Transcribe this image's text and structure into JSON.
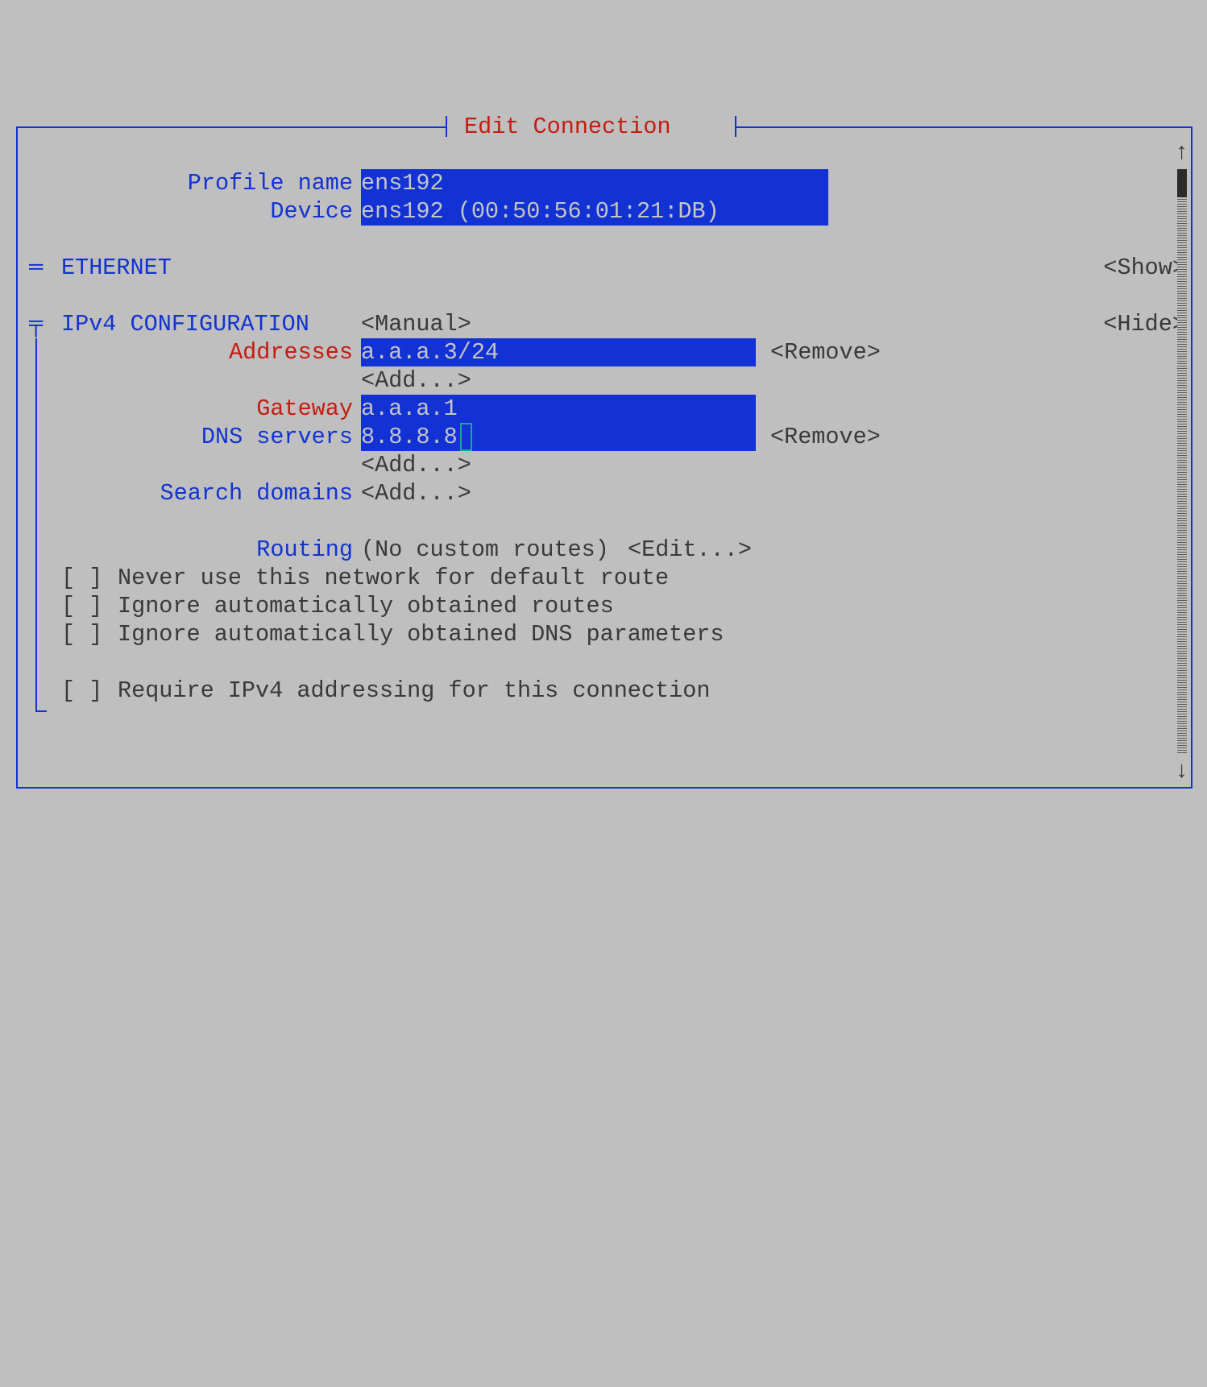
{
  "title": "Edit Connection",
  "labels": {
    "profile_name": "Profile name",
    "device": "Device",
    "ethernet": "ETHERNET",
    "ipv4": "IPv4 CONFIGURATION",
    "addresses": "Addresses",
    "gateway": "Gateway",
    "dns": "DNS servers",
    "search_domains": "Search domains",
    "routing": "Routing"
  },
  "buttons": {
    "show": "<Show>",
    "hide": "<Hide>",
    "manual": "<Manual>",
    "remove": "<Remove>",
    "add": "<Add...>",
    "edit": "<Edit...>"
  },
  "fields": {
    "profile_name": "ens192",
    "device": "ens192 (00:50:56:01:21:DB)",
    "address0": "a.a.a.3/24",
    "gateway": "a.a.a.1",
    "dns0": "8.8.8.8"
  },
  "ipv4_mode_selected": "Manual",
  "routing_status": "(No custom routes)",
  "checkboxes": {
    "no_default": {
      "checked": false,
      "label": "Never use this network for default route"
    },
    "ignore_routes": {
      "checked": false,
      "label": "Ignore automatically obtained routes"
    },
    "ignore_dns": {
      "checked": false,
      "label": "Ignore automatically obtained DNS parameters"
    },
    "require_ipv4": {
      "checked": false,
      "label": "Require IPv4 addressing for this connection"
    }
  },
  "scroll": {
    "up_arrow": "↑",
    "down_arrow": "↓"
  },
  "tree": {
    "eq": "=",
    "tee": "╤",
    "bar": "│",
    "elb": "└"
  }
}
